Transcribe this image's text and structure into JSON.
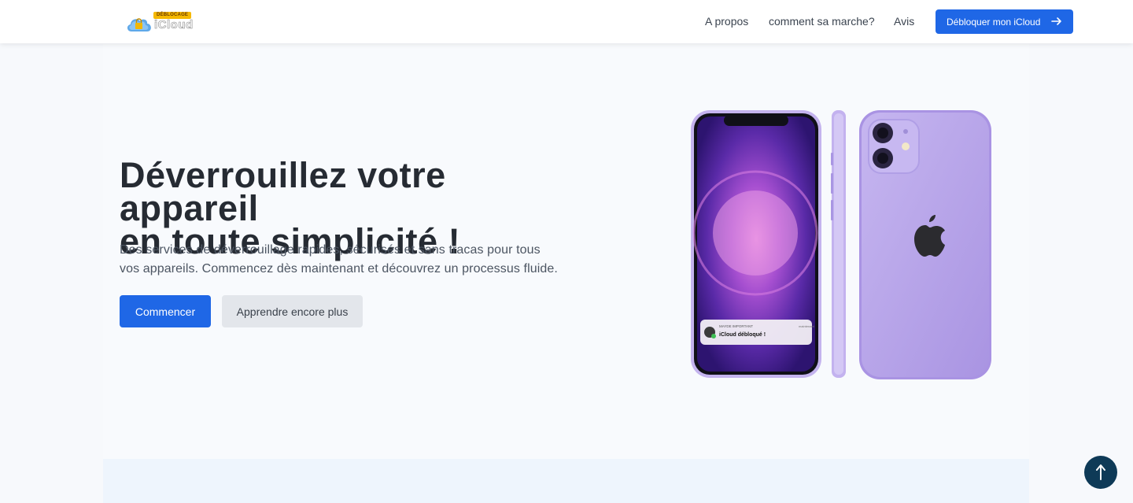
{
  "header": {
    "logo": {
      "badge": "DÉBLOCAGE",
      "wordmark": "iCloud",
      "icon": "cloud-lock-icon"
    },
    "nav": [
      {
        "label": "A propos"
      },
      {
        "label": "comment sa marche?"
      },
      {
        "label": "Avis"
      }
    ],
    "cta": {
      "label": "Débloquer mon iCloud",
      "icon": "arrow-right-icon"
    }
  },
  "hero": {
    "title_line1": "Déverrouillez votre appareil",
    "title_line2": "en toute simplicité !",
    "subtitle": "Des services de déverrouillage rapides, sécurisés et sans tracas pour tous vos appareils. Commencez dès maintenant et découvrez un processus fluide.",
    "primary_button": "Commencer",
    "secondary_button": "Apprendre encore plus"
  },
  "notification": {
    "app": "MAYDE IMPORTANT",
    "time": "maintenant",
    "message": "iCloud débloqué !"
  },
  "scroll_top": {
    "icon": "arrow-up-icon"
  },
  "colors": {
    "primary": "#1f67e6",
    "scroll_button": "#0e3a57",
    "phone_purple": "#b9a7ea"
  }
}
